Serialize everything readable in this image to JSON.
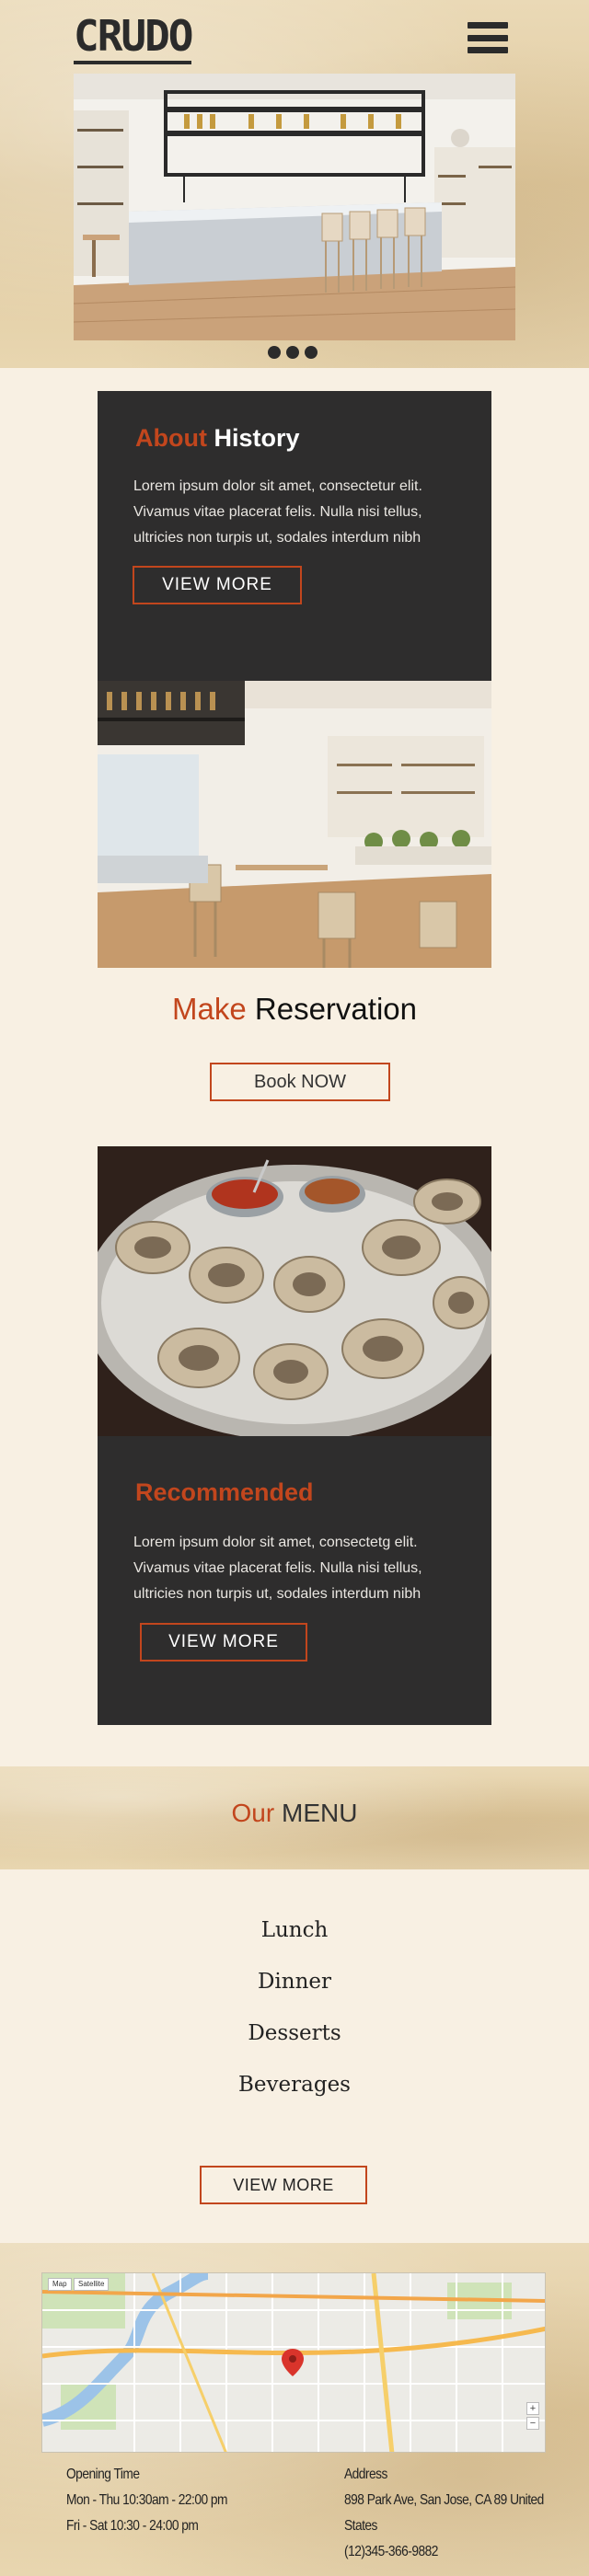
{
  "header": {
    "logo": "CRUDO",
    "menu_icon": "hamburger-menu-icon"
  },
  "hero": {
    "image_desc": "restaurant-bar-interior",
    "slider_dots": 3
  },
  "about": {
    "title_accent": "About",
    "title_rest": "History",
    "text": "Lorem ipsum dolor sit amet, consectetur  elit. Vivamus vitae placerat felis. Nulla nisi tellus, ultricies non turpis ut, sodales interdum nibh",
    "button": "VIEW MORE"
  },
  "reservation": {
    "title_accent": "Make",
    "title_rest": "Reservation",
    "button": "Book NOW"
  },
  "recommended": {
    "title": "Recommended",
    "text": "Lorem ipsum dolor sit amet, consectetg elit. Vivamus vitae placerat felis. Nulla nisi tellus, ultricies non turpis ut, sodales interdum nibh",
    "button": "VIEW MORE"
  },
  "menu": {
    "title_accent": "Our",
    "title_rest": "MENU",
    "items": [
      "Lunch",
      "Dinner",
      "Desserts",
      "Beverages"
    ],
    "button": "VIEW MORE"
  },
  "footer": {
    "map_tags": [
      "Map",
      "Satellite"
    ],
    "opening_label": "Opening Time",
    "hours": [
      "Mon - Thu 10:30am - 22:00 pm",
      "Fri - Sat 10:30 - 24:00 pm"
    ],
    "address_label": "Address",
    "address": "898 Park Ave, San Jose, CA 89 United States",
    "phone": "(12)345-366-9882"
  },
  "colors": {
    "accent": "#c2461d",
    "dark_card": "#2e2d2d",
    "page_bg": "#f8f0e3"
  }
}
